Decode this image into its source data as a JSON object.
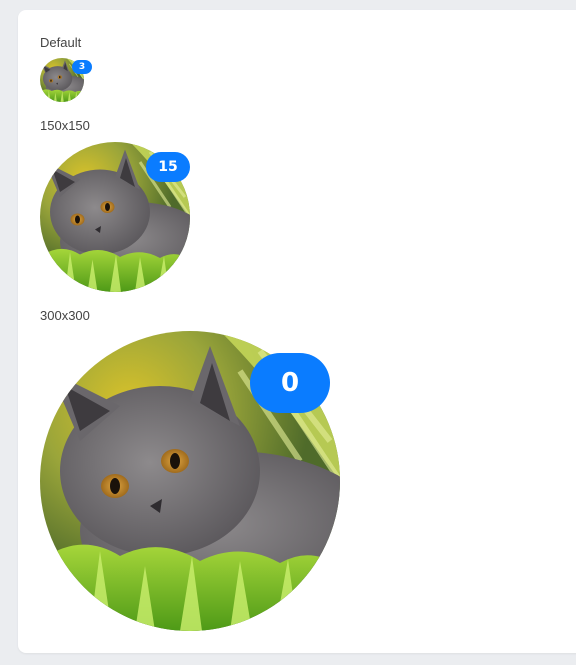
{
  "sections": [
    {
      "label": "Default",
      "badge": "3"
    },
    {
      "label": "150x150",
      "badge": "15"
    },
    {
      "label": "300x300",
      "badge": "0"
    }
  ],
  "avatar": {
    "subject": "gray kitten lying in grass",
    "icon": "cat-photo"
  },
  "colors": {
    "page_bg": "#ebedf0",
    "card_bg": "#ffffff",
    "badge_bg": "#0a7cff",
    "badge_text": "#ffffff"
  }
}
